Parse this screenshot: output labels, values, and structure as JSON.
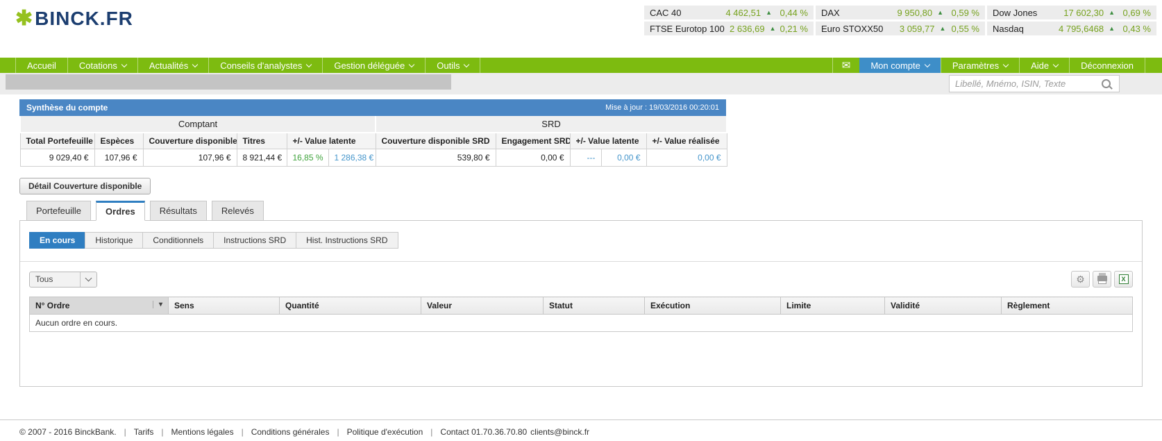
{
  "colors": {
    "brand_green": "#7DBB10",
    "logo_navy": "#1C3E70",
    "star_green": "#95C11F",
    "header_blue": "#4A86C4",
    "active_nav_blue": "#3E8EC8",
    "active_subtab_blue": "#2F7EC1",
    "positive_green": "#3FA33C",
    "ticker_green": "#76A21E",
    "value_blue": "#4495CB"
  },
  "icons": {
    "logo_star": "✱",
    "up_arrow": "▲",
    "sort_arrow": "▾",
    "gear": "⚙",
    "envelope": "✉",
    "excel_letter": "X"
  },
  "brand": {
    "name": "BINCK.FR"
  },
  "market": {
    "indices": [
      {
        "name": "CAC 40",
        "value": "4 462,51",
        "direction": "up",
        "change": "0,44 %"
      },
      {
        "name": "DAX",
        "value": "9 950,80",
        "direction": "up",
        "change": "0,59 %"
      },
      {
        "name": "Dow Jones",
        "value": "17 602,30",
        "direction": "up",
        "change": "0,69 %"
      },
      {
        "name": "FTSE Eurotop 100",
        "value": "2 636,69",
        "direction": "up",
        "change": "0,21 %"
      },
      {
        "name": "Euro STOXX50",
        "value": "3 059,77",
        "direction": "up",
        "change": "0,55 %"
      },
      {
        "name": "Nasdaq",
        "value": "4 795,6468",
        "direction": "up",
        "change": "0,43 %"
      }
    ]
  },
  "nav": {
    "left": [
      {
        "label": "Accueil",
        "dropdown": false
      },
      {
        "label": "Cotations",
        "dropdown": true
      },
      {
        "label": "Actualités",
        "dropdown": true
      },
      {
        "label": "Conseils d'analystes",
        "dropdown": true
      },
      {
        "label": "Gestion déléguée",
        "dropdown": true
      },
      {
        "label": "Outils",
        "dropdown": true
      }
    ],
    "right": [
      {
        "label": "Mon compte",
        "dropdown": true,
        "active": true
      },
      {
        "label": "Paramètres",
        "dropdown": true
      },
      {
        "label": "Aide",
        "dropdown": true
      },
      {
        "label": "Déconnexion",
        "dropdown": false
      }
    ]
  },
  "search": {
    "placeholder": "Libellé, Mnémo, ISIN, Texte"
  },
  "summary": {
    "title": "Synthèse du compte",
    "updated": "Mise à jour : 19/03/2016 00:20:01",
    "group_comptant": "Comptant",
    "group_srd": "SRD",
    "col_total": "Total Portefeuille",
    "col_especes": "Espèces",
    "col_couverture": "Couverture disponible",
    "col_titres": "Titres",
    "col_value_latente": "+/- Value latente",
    "col_couverture_srd": "Couverture disponible SRD",
    "col_engagement_srd": "Engagement SRD",
    "col_value_latente_srd": "+/- Value latente",
    "col_value_realisee": "+/- Value réalisée",
    "val_total": "9 029,40 €",
    "val_especes": "107,96 €",
    "val_couverture": "107,96 €",
    "val_titres": "8 921,44 €",
    "val_latente_pct": "16,85 %",
    "val_latente_eur": "1 286,38 €",
    "val_couverture_srd": "539,80 €",
    "val_engagement_srd": "0,00 €",
    "val_latente_srd_pct": "---",
    "val_latente_srd_eur": "0,00 €",
    "val_realisee": "0,00 €"
  },
  "detail_button": {
    "label": "Détail Couverture disponible"
  },
  "tabs": [
    {
      "label": "Portefeuille",
      "active": false
    },
    {
      "label": "Ordres",
      "active": true
    },
    {
      "label": "Résultats",
      "active": false
    },
    {
      "label": "Relevés",
      "active": false
    }
  ],
  "subtabs": [
    {
      "label": "En cours",
      "active": true
    },
    {
      "label": "Historique",
      "active": false
    },
    {
      "label": "Conditionnels",
      "active": false
    },
    {
      "label": "Instructions SRD",
      "active": false
    },
    {
      "label": "Hist. Instructions SRD",
      "active": false
    }
  ],
  "orders": {
    "filter": "Tous",
    "columns": [
      "N° Ordre",
      "Sens",
      "Quantité",
      "Valeur",
      "Statut",
      "Exécution",
      "Limite",
      "Validité",
      "Règlement"
    ],
    "empty": "Aucun ordre en cours."
  },
  "footer": {
    "copyright": "© 2007 - 2016 BinckBank.",
    "separator": "|",
    "links": [
      "Tarifs",
      "Mentions légales",
      "Conditions générales",
      "Politique d'exécution"
    ],
    "contact": "Contact 01.70.36.70.80",
    "email": "clients@binck.fr"
  }
}
